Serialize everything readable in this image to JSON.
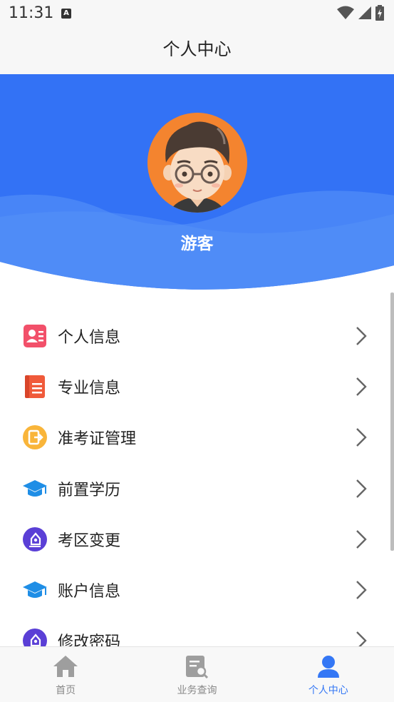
{
  "status_bar": {
    "time": "11:31",
    "notification_letter": "A"
  },
  "title_bar": {
    "title": "个人中心"
  },
  "profile": {
    "username": "游客"
  },
  "colors": {
    "accent": "#3477f5",
    "header_blue": "#3f7ff7",
    "avatar_bg": "#f4842f"
  },
  "menu": {
    "items": [
      {
        "label": "个人信息",
        "icon": "id-card-icon"
      },
      {
        "label": "专业信息",
        "icon": "book-icon"
      },
      {
        "label": "准考证管理",
        "icon": "admission-ticket-icon"
      },
      {
        "label": "前置学历",
        "icon": "graduation-cap-icon"
      },
      {
        "label": "考区变更",
        "icon": "pen-edit-icon"
      },
      {
        "label": "账户信息",
        "icon": "graduation-cap-icon"
      },
      {
        "label": "修改密码",
        "icon": "pen-edit-icon"
      }
    ]
  },
  "tabbar": {
    "tabs": [
      {
        "label": "首页",
        "icon": "home-icon",
        "active": false
      },
      {
        "label": "业务查询",
        "icon": "document-search-icon",
        "active": false
      },
      {
        "label": "个人中心",
        "icon": "person-icon",
        "active": true
      }
    ]
  }
}
